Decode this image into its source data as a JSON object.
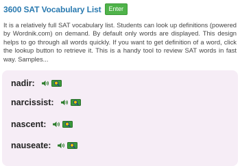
{
  "header": {
    "title": "3600 SAT Vocabulary List",
    "enter_label": "Enter"
  },
  "intro": {
    "text": "It is a relatively full SAT vocabulary list. Students can look up definitions (powered by Wordnik.com) on demand. By default only words are displayed. This design helps to go through all words quickly. If you want to get definition of a word, click the lookup button to retrieve it. This is a handy tool to review SAT words in fast way. Samples..."
  },
  "words": [
    {
      "label": "nadir:"
    },
    {
      "label": "narcissist:"
    },
    {
      "label": "nascent:"
    },
    {
      "label": "nauseate:"
    }
  ],
  "icons": {
    "speaker": "speaker-icon",
    "lookup": "lookup-icon"
  },
  "colors": {
    "title": "#2a7ab0",
    "enter_button": "#4fb34a",
    "list_background": "#f6edf6"
  }
}
